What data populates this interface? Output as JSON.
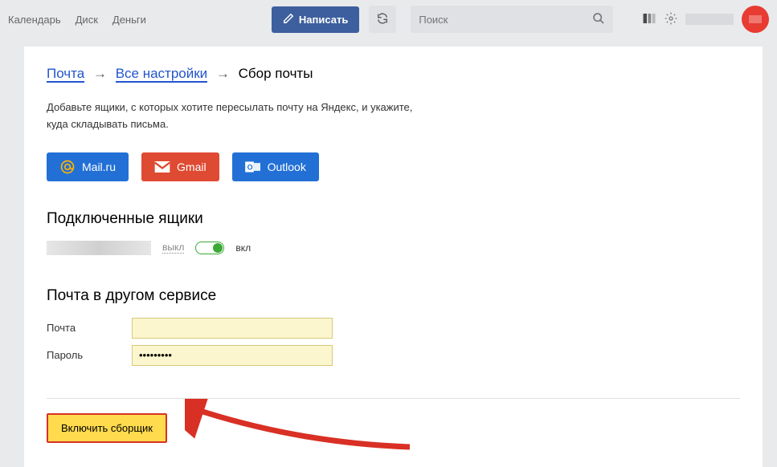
{
  "topbar": {
    "links": [
      "Календарь",
      "Диск",
      "Деньги"
    ],
    "compose_label": "Написать",
    "search_placeholder": "Поиск"
  },
  "breadcrumb": {
    "items": [
      "Почта",
      "Все настройки"
    ],
    "current": "Сбор почты",
    "separator": "→"
  },
  "instruction": "Добавьте ящики, с которых хотите пересылать почту на Яндекс, и укажите, куда складывать письма.",
  "providers": {
    "mailru": "Mail.ru",
    "gmail": "Gmail",
    "outlook": "Outlook"
  },
  "sections": {
    "connected_title": "Подключенные ящики",
    "other_service_title": "Почта в другом сервисе"
  },
  "toggle": {
    "off_label": "выкл",
    "on_label": "вкл"
  },
  "form": {
    "email_label": "Почта",
    "email_value": "",
    "password_label": "Пароль",
    "password_value": "•••••••••"
  },
  "submit": {
    "label": "Включить сборщик"
  }
}
